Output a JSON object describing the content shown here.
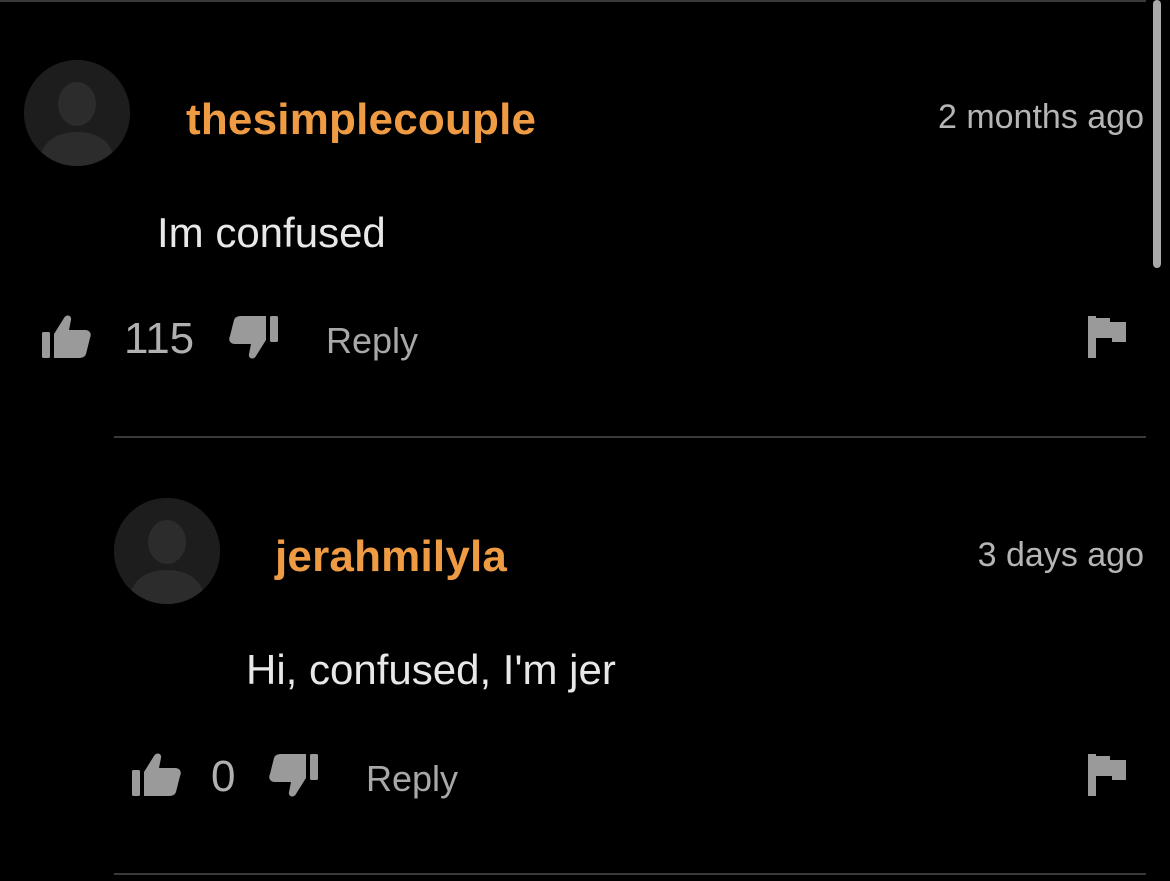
{
  "colors": {
    "background": "#000000",
    "username": "#ef9b43",
    "icon": "#9a9a9a",
    "divider": "#3a3a3a"
  },
  "comments": [
    {
      "username": "thesimplecouple",
      "timestamp": "2 months ago",
      "text": "Im confused",
      "likes": "115",
      "reply_label": "Reply",
      "avatar_icon": "default-user-avatar-icon"
    },
    {
      "username": "jerahmilyla",
      "timestamp": "3 days ago",
      "text": "Hi, confused, I'm jer",
      "likes": "0",
      "reply_label": "Reply",
      "avatar_icon": "default-user-avatar-icon"
    }
  ],
  "icons": {
    "like": "thumbs-up-icon",
    "dislike": "thumbs-down-icon",
    "flag": "flag-icon"
  }
}
